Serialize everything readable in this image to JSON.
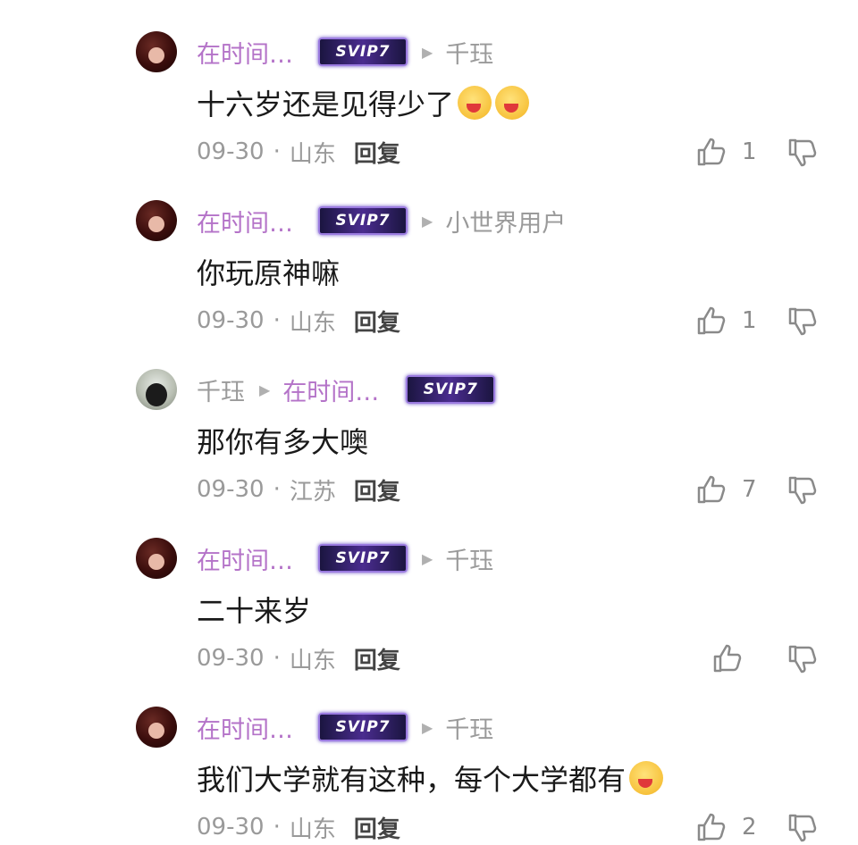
{
  "comments": [
    {
      "name": "在时间…",
      "badge": "SVIP7",
      "reply_to": "千珏",
      "text": "十六岁还是见得少了",
      "emojis": 2,
      "date": "09-30",
      "location": "山东",
      "reply_label": "回复",
      "likes": "1"
    },
    {
      "name": "在时间…",
      "badge": "SVIP7",
      "reply_to": "小世界用户",
      "text": "你玩原神嘛",
      "emojis": 0,
      "date": "09-30",
      "location": "山东",
      "reply_label": "回复",
      "likes": "1"
    },
    {
      "name": "千珏",
      "badge": "SVIP7",
      "reply_to": "在时间…",
      "text": "那你有多大噢",
      "emojis": 0,
      "date": "09-30",
      "location": "江苏",
      "reply_label": "回复",
      "likes": "7"
    },
    {
      "name": "在时间…",
      "badge": "SVIP7",
      "reply_to": "千珏",
      "text": "二十来岁",
      "emojis": 0,
      "date": "09-30",
      "location": "山东",
      "reply_label": "回复",
      "likes": ""
    },
    {
      "name": "在时间…",
      "badge": "SVIP7",
      "reply_to": "千珏",
      "text": "我们大学就有这种，每个大学都有",
      "emojis": 1,
      "date": "09-30",
      "location": "山东",
      "reply_label": "回复",
      "likes": "2"
    }
  ],
  "colors": {
    "username_purple": "#b473c8",
    "meta_gray": "#9a9a9a",
    "badge_bg": "#2a1f5e"
  },
  "icons": {
    "like": "thumbs-up-icon",
    "dislike": "thumbs-down-icon",
    "arrow": "reply-arrow-icon",
    "emoji": "drooling-face-emoji"
  },
  "separator": "·"
}
